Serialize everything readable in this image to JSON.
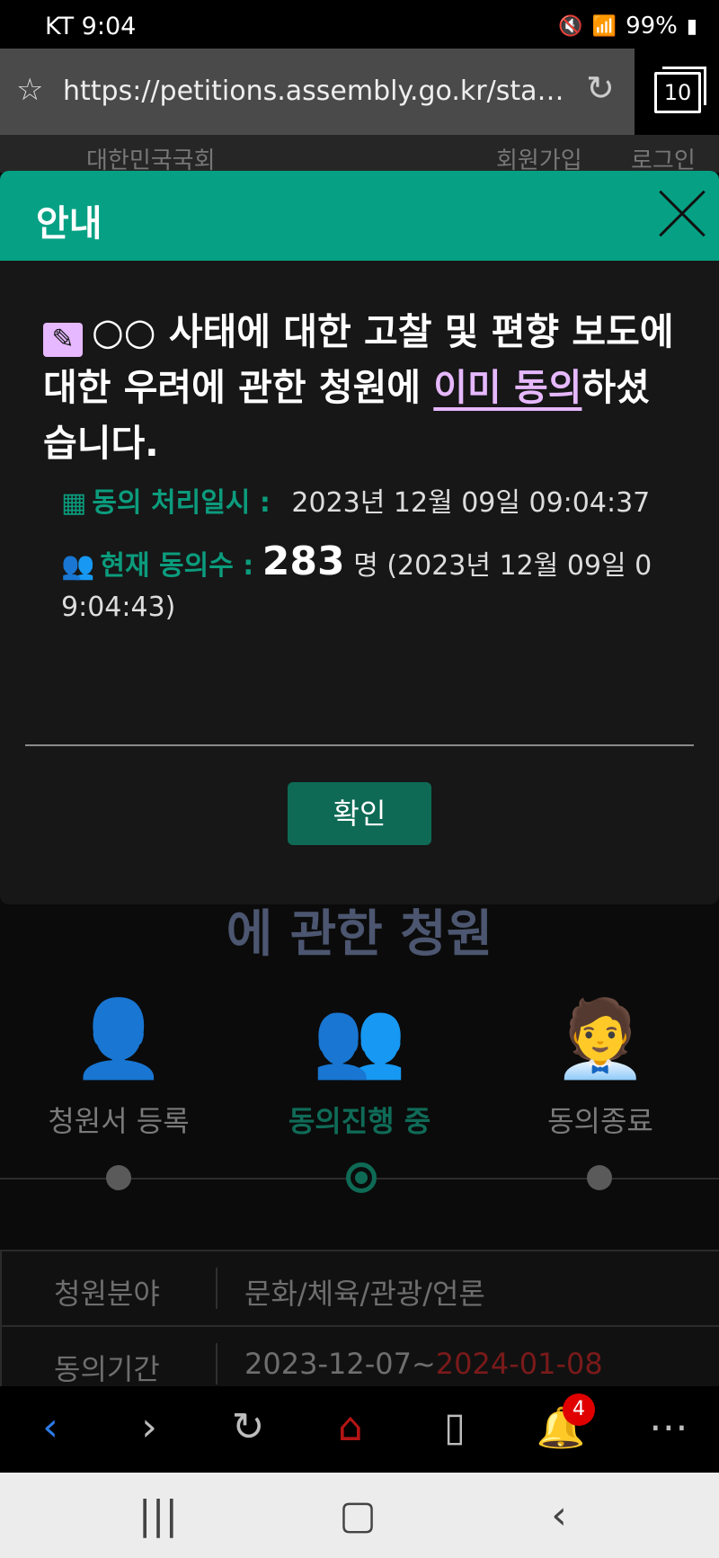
{
  "status": {
    "carrier": "KT 9:04",
    "battery": "99%"
  },
  "browser": {
    "url": "https://petitions.assembly.go.kr/sta…",
    "tab_count": "10"
  },
  "bg": {
    "header_left": "대한민국국회",
    "header_join": "회원가입",
    "header_login": "로그인",
    "title_fragment": "에 관한 청원",
    "steps": [
      "청원서 등록",
      "동의진행 중",
      "동의종료"
    ],
    "table": [
      {
        "key": "청원분야",
        "value": "문화/체육/관광/언론"
      },
      {
        "key": "동의기간",
        "start": "2023-12-07~",
        "end": "2024-01-08"
      }
    ]
  },
  "modal": {
    "title": "안내",
    "message_pre": "○○ 사태에 대한 고찰 및 편향 보도에 대한 우려에 관한 청원에 ",
    "message_link": "이미 동의",
    "message_post": "하셨습니다.",
    "processed_label": "동의 처리일시 :",
    "processed_value": "2023년 12월 09일 09:04:37",
    "count_label": "현재 동의수 :",
    "count_value": "283",
    "count_unit": "명 (2023년 12월 09일 0",
    "count_time_cont": "9:04:43)",
    "ok_label": "확인"
  },
  "navbar": {
    "notification_count": "4"
  },
  "colors": {
    "accent": "#06a184",
    "link": "#e6b8ff",
    "button": "#0e6a55"
  }
}
